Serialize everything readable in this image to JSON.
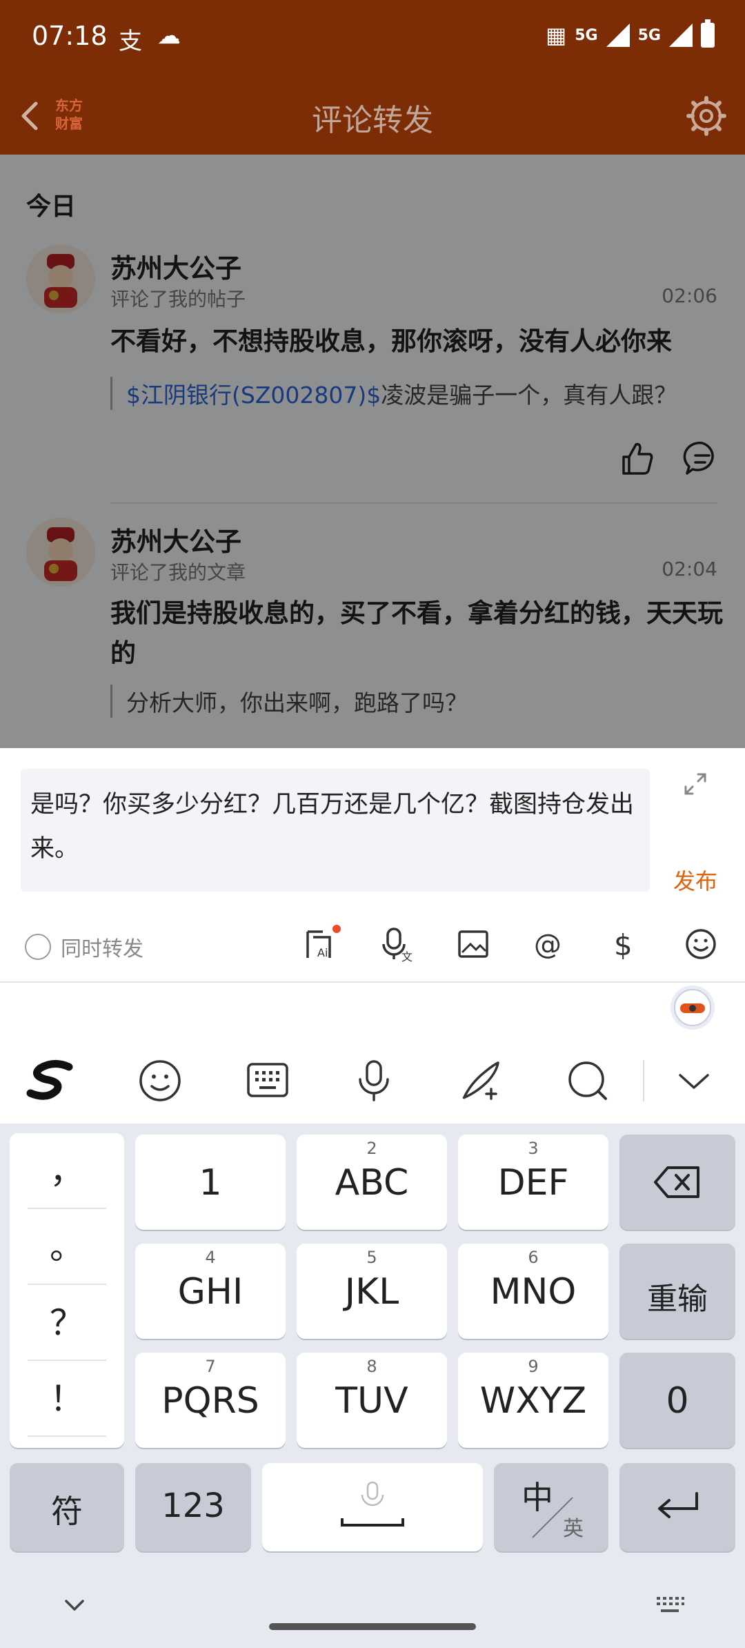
{
  "status_bar": {
    "time": "07:18",
    "left_icons": [
      "支",
      "☁"
    ],
    "network_1": "5G",
    "network_2": "5G"
  },
  "nav": {
    "title": "评论转发",
    "logo_text": "东方财富"
  },
  "section": {
    "title": "今日"
  },
  "notifications": [
    {
      "username": "苏州大公子",
      "action": "评论了我的帖子",
      "time": "02:06",
      "comment": "不看好，不想持股收息，那你滚呀，没有人必你来",
      "quote_link": "$江阴银行(SZ002807)$",
      "quote_text": "凌波是骗子一个，真有人跟？"
    },
    {
      "username": "苏州大公子",
      "action": "评论了我的文章",
      "time": "02:04",
      "comment": "我们是持股收息的，买了不看，拿着分红的钱，天天玩的",
      "quote_link": "",
      "quote_text": "分析大师，你出来啊，跑路了吗？"
    }
  ],
  "compose": {
    "text": "是吗？你买多少分红？几百万还是几个亿？截图持仓发出来。",
    "publish_label": "发布",
    "repost_label": "同时转发"
  },
  "keyboard": {
    "punct": [
      "，",
      "。",
      "？",
      "！"
    ],
    "rows": [
      [
        {
          "num": "",
          "label": "1"
        },
        {
          "num": "2",
          "label": "ABC"
        },
        {
          "num": "3",
          "label": "DEF"
        }
      ],
      [
        {
          "num": "4",
          "label": "GHI"
        },
        {
          "num": "5",
          "label": "JKL"
        },
        {
          "num": "6",
          "label": "MNO"
        }
      ],
      [
        {
          "num": "7",
          "label": "PQRS"
        },
        {
          "num": "8",
          "label": "TUV"
        },
        {
          "num": "9",
          "label": "WXYZ"
        }
      ]
    ],
    "retype_label": "重输",
    "zero_label": "0",
    "symbol_label": "符",
    "num_label": "123",
    "lang_main": "中",
    "lang_sub": "英"
  },
  "colors": {
    "header": "#7d2d06",
    "accent": "#e0620e",
    "link": "#2a62d6"
  }
}
